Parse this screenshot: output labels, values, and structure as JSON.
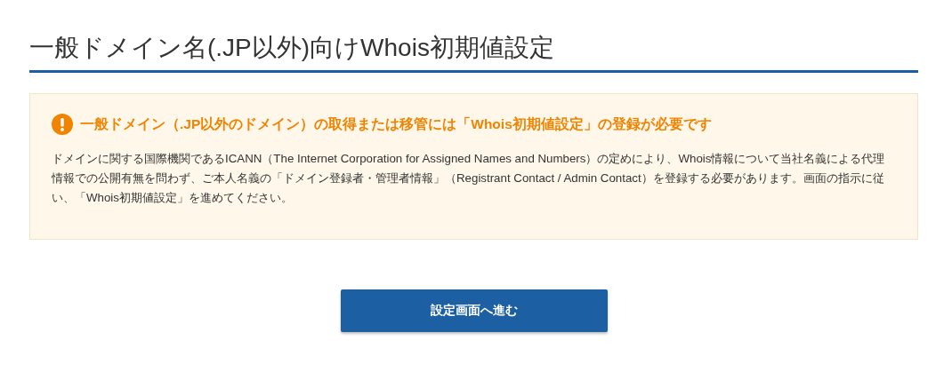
{
  "heading": "一般ドメイン名(.JP以外)向けWhois初期値設定",
  "notice": {
    "kind": "warning",
    "title": "一般ドメイン（.JP以外のドメイン）の取得または移管には「Whois初期値設定」の登録が必要です",
    "body": "ドメインに関する国際機関であるICANN（The Internet Corporation for Assigned Names and Numbers）の定めにより、Whois情報について当社名義による代理情報での公開有無を問わず、ご本人名義の「ドメイン登録者・管理者情報」（Registrant Contact / Admin Contact）を登録する必要があります。画面の指示に従い、「Whois初期値設定」を進めてください。"
  },
  "button": "設定画面へ進む"
}
